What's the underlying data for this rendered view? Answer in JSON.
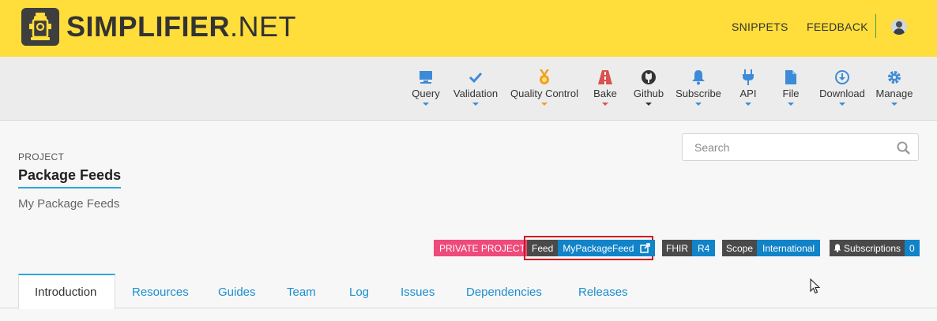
{
  "header": {
    "brand": "SIMPLIFIER",
    "brand_suffix": ".NET",
    "nav": [
      {
        "label": "SNIPPETS"
      },
      {
        "label": "FEEDBACK"
      }
    ]
  },
  "toolbar": {
    "items": [
      {
        "label": "Query",
        "icon": "monitor-icon",
        "color": "#3d8bd8"
      },
      {
        "label": "Validation",
        "icon": "check-icon",
        "color": "#3d8bd8"
      },
      {
        "label": "Quality Control",
        "icon": "medal-icon",
        "color": "#f1a11e"
      },
      {
        "label": "Bake",
        "icon": "road-icon",
        "color": "#d9534f"
      },
      {
        "label": "Github",
        "icon": "github-icon",
        "color": "#333333"
      },
      {
        "label": "Subscribe",
        "icon": "bell-icon",
        "color": "#3d8bd8"
      },
      {
        "label": "API",
        "icon": "plug-icon",
        "color": "#3d8bd8"
      },
      {
        "label": "File",
        "icon": "file-icon",
        "color": "#3d8bd8"
      },
      {
        "label": "Download",
        "icon": "download-icon",
        "color": "#3d8bd8"
      },
      {
        "label": "Manage",
        "icon": "gear-icon",
        "color": "#3d8bd8"
      }
    ]
  },
  "project": {
    "kicker": "PROJECT",
    "title": "Package Feeds",
    "subtitle": "My Package Feeds"
  },
  "search": {
    "placeholder": "Search"
  },
  "badges": {
    "private": "PRIVATE PROJECT",
    "feed_label": "Feed",
    "feed_value": "MyPackageFeed",
    "fhir_label": "FHIR",
    "fhir_value": "R4",
    "scope_label": "Scope",
    "scope_value": "International",
    "subs_label": "Subscriptions",
    "subs_value": "0"
  },
  "tabs": [
    {
      "label": "Introduction",
      "active": true
    },
    {
      "label": "Resources"
    },
    {
      "label": "Guides"
    },
    {
      "label": "Team"
    },
    {
      "label": "Log"
    },
    {
      "label": "Issues"
    },
    {
      "label": "Dependencies"
    },
    {
      "label": "Releases"
    }
  ],
  "colors": {
    "header_bg": "#ffdd3a",
    "accent_blue": "#1183c8",
    "private_pink": "#ee4a7a",
    "highlight_red": "#d0141f"
  }
}
